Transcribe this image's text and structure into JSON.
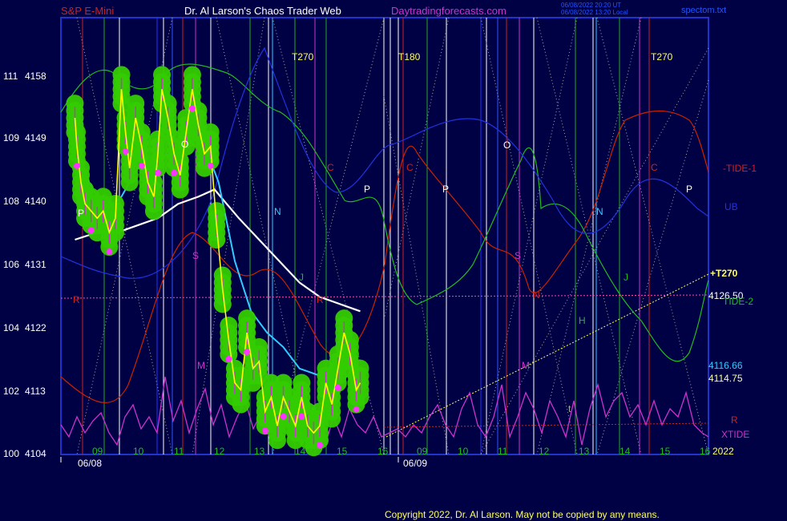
{
  "header": {
    "symbol": "S&P E-Mini",
    "site": "Dr. Al Larson's Chaos Trader Web",
    "domain": "Daytradingforecasts.com",
    "stamp1": "06/08/2022 20:20 UT",
    "stamp2": "06/08/2022 13:20 Local",
    "file": "spectom.txt"
  },
  "footer": {
    "copyright": "Copyright 2022, Dr. Al Larson. May not be copied by any means."
  },
  "colors": {
    "background": "#000044",
    "price": "#ffff00",
    "price_bubbles": "#33cc00",
    "fast_ma": "#33ccff",
    "slow_ma": "#ffffff",
    "tide1": "#cc2200",
    "tide2": "#22bb22",
    "xtide": "#cc33cc",
    "ub": "#2233dd",
    "projection": "#ffff66"
  },
  "chart_data": {
    "type": "line",
    "title": "S&P E-Mini",
    "y_axis": {
      "range": [
        4104,
        4165
      ],
      "ticks": [
        {
          "left": "100",
          "right": "4104",
          "value": 4104
        },
        {
          "left": "102",
          "right": "4113",
          "value": 4113
        },
        {
          "left": "104",
          "right": "4122",
          "value": 4122
        },
        {
          "left": "106",
          "right": "4131",
          "value": 4131
        },
        {
          "left": "108",
          "right": "4140",
          "value": 4140
        },
        {
          "left": "109",
          "right": "4149",
          "value": 4149
        },
        {
          "left": "111",
          "right": "4158",
          "value": 4158
        }
      ]
    },
    "x_axis": {
      "hours": [
        "09",
        "10",
        "11",
        "12",
        "13",
        "14",
        "15",
        "16",
        "09",
        "10",
        "11",
        "12",
        "13",
        "14",
        "15",
        "16"
      ],
      "dates": [
        "06/08",
        "06/09"
      ],
      "year": "2022"
    },
    "time_labels": [
      "T270",
      "T180",
      "T270"
    ],
    "series": [
      {
        "name": "S&P E-Mini",
        "hours": [
          8.95,
          9.0,
          9.1,
          9.2,
          9.35,
          9.5,
          9.65,
          9.8,
          9.95,
          10.1,
          10.2,
          10.3,
          10.45,
          10.6,
          10.75,
          10.9,
          11.0,
          11.1,
          11.25,
          11.4,
          11.55,
          11.7,
          11.85,
          12.0,
          12.15,
          12.3,
          12.45,
          12.6,
          12.75,
          12.9,
          13.05,
          13.2,
          13.35,
          13.5,
          13.65,
          13.8,
          13.95,
          14.1,
          14.25,
          14.4,
          14.55,
          14.7,
          14.85,
          15.0,
          15.15,
          15.3,
          15.45,
          15.6,
          15.75,
          15.9,
          16.0
        ],
        "values": [
          4151,
          4147,
          4142,
          4139,
          4138,
          4137,
          4138,
          4135,
          4137,
          4155,
          4149,
          4144,
          4151,
          4147,
          4142,
          4140,
          4146,
          4155,
          4151,
          4146,
          4143,
          4149,
          4155,
          4150,
          4146,
          4147,
          4136,
          4127,
          4120,
          4114,
          4113,
          4121,
          4116,
          4117,
          4110,
          4112,
          4108,
          4112,
          4110,
          4108,
          4112,
          4108,
          4107,
          4108,
          4114,
          4111,
          4116,
          4121,
          4118,
          4113,
          4114
        ]
      },
      {
        "name": "fast average",
        "hours": [
          8.95,
          9.3,
          9.7,
          10.1,
          10.5,
          10.9,
          11.3,
          11.7,
          12.1,
          12.5,
          12.9,
          13.3,
          13.7,
          14.1,
          14.5,
          15.0,
          15.4,
          15.7,
          16.0
        ],
        "values": [
          4148,
          4142,
          4138,
          4140,
          4144,
          4145,
          4146,
          4148,
          4148,
          4142,
          4131,
          4124,
          4121,
          4119,
          4116,
          4115,
          4114,
          4115,
          4115
        ]
      },
      {
        "name": "slow average",
        "hours": [
          8.95,
          9.5,
          10.0,
          10.5,
          11.0,
          11.5,
          12.0,
          12.4,
          12.7,
          13.0,
          13.5,
          14.0,
          14.5,
          15.0,
          15.5,
          16.0
        ],
        "values": [
          4134,
          4135,
          4135,
          4136,
          4137,
          4139,
          4140,
          4141,
          4139,
          4137,
          4134,
          4131,
          4128,
          4126,
          4125,
          4124
        ]
      }
    ],
    "annotations": {
      "right_labels": [
        {
          "text": "-TIDE-1",
          "color": "#cc2222"
        },
        {
          "text": "UB",
          "color": "#2233dd"
        },
        {
          "text": "+T270",
          "color": "#ffff66"
        },
        {
          "text": "4126.50",
          "color": "#ffffff"
        },
        {
          "text": "TIDE-2",
          "color": "#22bb22"
        },
        {
          "text": "4116.66",
          "color": "#33ccff"
        },
        {
          "text": "4114.75",
          "color": "#ffffaa"
        },
        {
          "text": "R",
          "color": "#cc2222"
        },
        {
          "text": "XTIDE",
          "color": "#cc33cc"
        }
      ],
      "chart_letters": [
        "O",
        "C",
        "C",
        "C",
        "P",
        "P",
        "P",
        "P",
        "S",
        "S",
        "N",
        "N",
        "N",
        "J",
        "J",
        "R",
        "R",
        "H",
        "M",
        "M",
        "t",
        "O"
      ]
    }
  }
}
